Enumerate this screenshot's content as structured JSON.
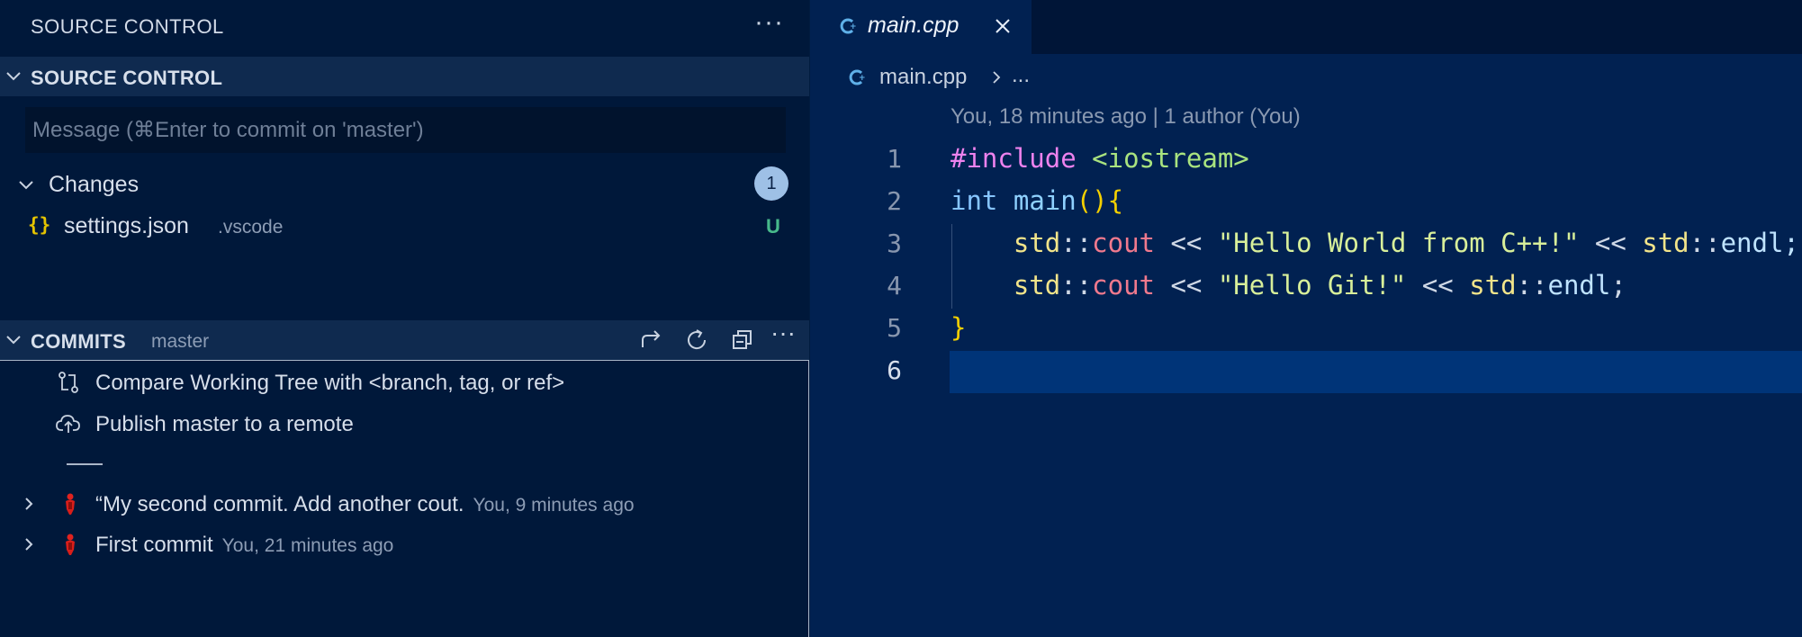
{
  "sidebar": {
    "title": "SOURCE CONTROL",
    "more_icon": "more-horizontal-icon",
    "source_control": {
      "header": "SOURCE CONTROL",
      "commit_placeholder": "Message (⌘Enter to commit on 'master')",
      "changes": {
        "label": "Changes",
        "count": "1",
        "files": [
          {
            "icon": "{}",
            "name": "settings.json",
            "folder": ".vscode",
            "status": "U"
          }
        ]
      }
    },
    "commits": {
      "header": "COMMITS",
      "branch": "master",
      "actions": [
        "compare-icon",
        "refresh-icon",
        "collapse-all-icon",
        "more-horizontal-icon"
      ],
      "items": [
        {
          "icon": "compare-changes-icon",
          "label": "Compare Working Tree with <branch, tag, or ref>"
        },
        {
          "icon": "cloud-upload-icon",
          "label": "Publish master to a remote"
        }
      ],
      "history": [
        {
          "message": "“My second commit. Add another cout.",
          "meta": "You, 9 minutes ago"
        },
        {
          "message": "First commit",
          "meta": "You, 21 minutes ago"
        }
      ]
    }
  },
  "editor": {
    "tab": {
      "name": "main.cpp",
      "icon": "cpp-file-icon"
    },
    "breadcrumb": {
      "file": "main.cpp",
      "more": "..."
    },
    "blame": "You, 18 minutes ago | 1 author (You)",
    "lines": [
      {
        "n": "1",
        "tokens": [
          [
            "pp",
            "#include"
          ],
          [
            "op",
            " "
          ],
          [
            "inc",
            "<iostream>"
          ]
        ]
      },
      {
        "n": "2",
        "tokens": [
          [
            "kw",
            "int"
          ],
          [
            "op",
            " "
          ],
          [
            "fn",
            "main"
          ],
          [
            "paren",
            "()"
          ],
          [
            "paren",
            "{"
          ]
        ]
      },
      {
        "n": "3",
        "tokens": [
          [
            "op",
            "    "
          ],
          [
            "ns",
            "std"
          ],
          [
            "op",
            "::"
          ],
          [
            "id",
            "cout"
          ],
          [
            "op",
            " << "
          ],
          [
            "str",
            "\"Hello World from C++!\""
          ],
          [
            "op",
            " << "
          ],
          [
            "ns",
            "std"
          ],
          [
            "op",
            "::"
          ],
          [
            "endl",
            "endl;"
          ]
        ]
      },
      {
        "n": "4",
        "tokens": [
          [
            "op",
            "    "
          ],
          [
            "ns",
            "std"
          ],
          [
            "op",
            "::"
          ],
          [
            "id",
            "cout"
          ],
          [
            "op",
            " << "
          ],
          [
            "str",
            "\"Hello Git!\""
          ],
          [
            "op",
            " << "
          ],
          [
            "ns",
            "std"
          ],
          [
            "op",
            "::"
          ],
          [
            "endl",
            "endl"
          ],
          [
            "op",
            ";"
          ]
        ]
      },
      {
        "n": "5",
        "tokens": [
          [
            "paren",
            "}"
          ]
        ]
      },
      {
        "n": "6",
        "tokens": []
      }
    ]
  },
  "colors": {
    "sidebar_bg": "#00183a",
    "editor_bg": "#012151",
    "active_line": "#003478",
    "untracked": "#47b98b"
  }
}
